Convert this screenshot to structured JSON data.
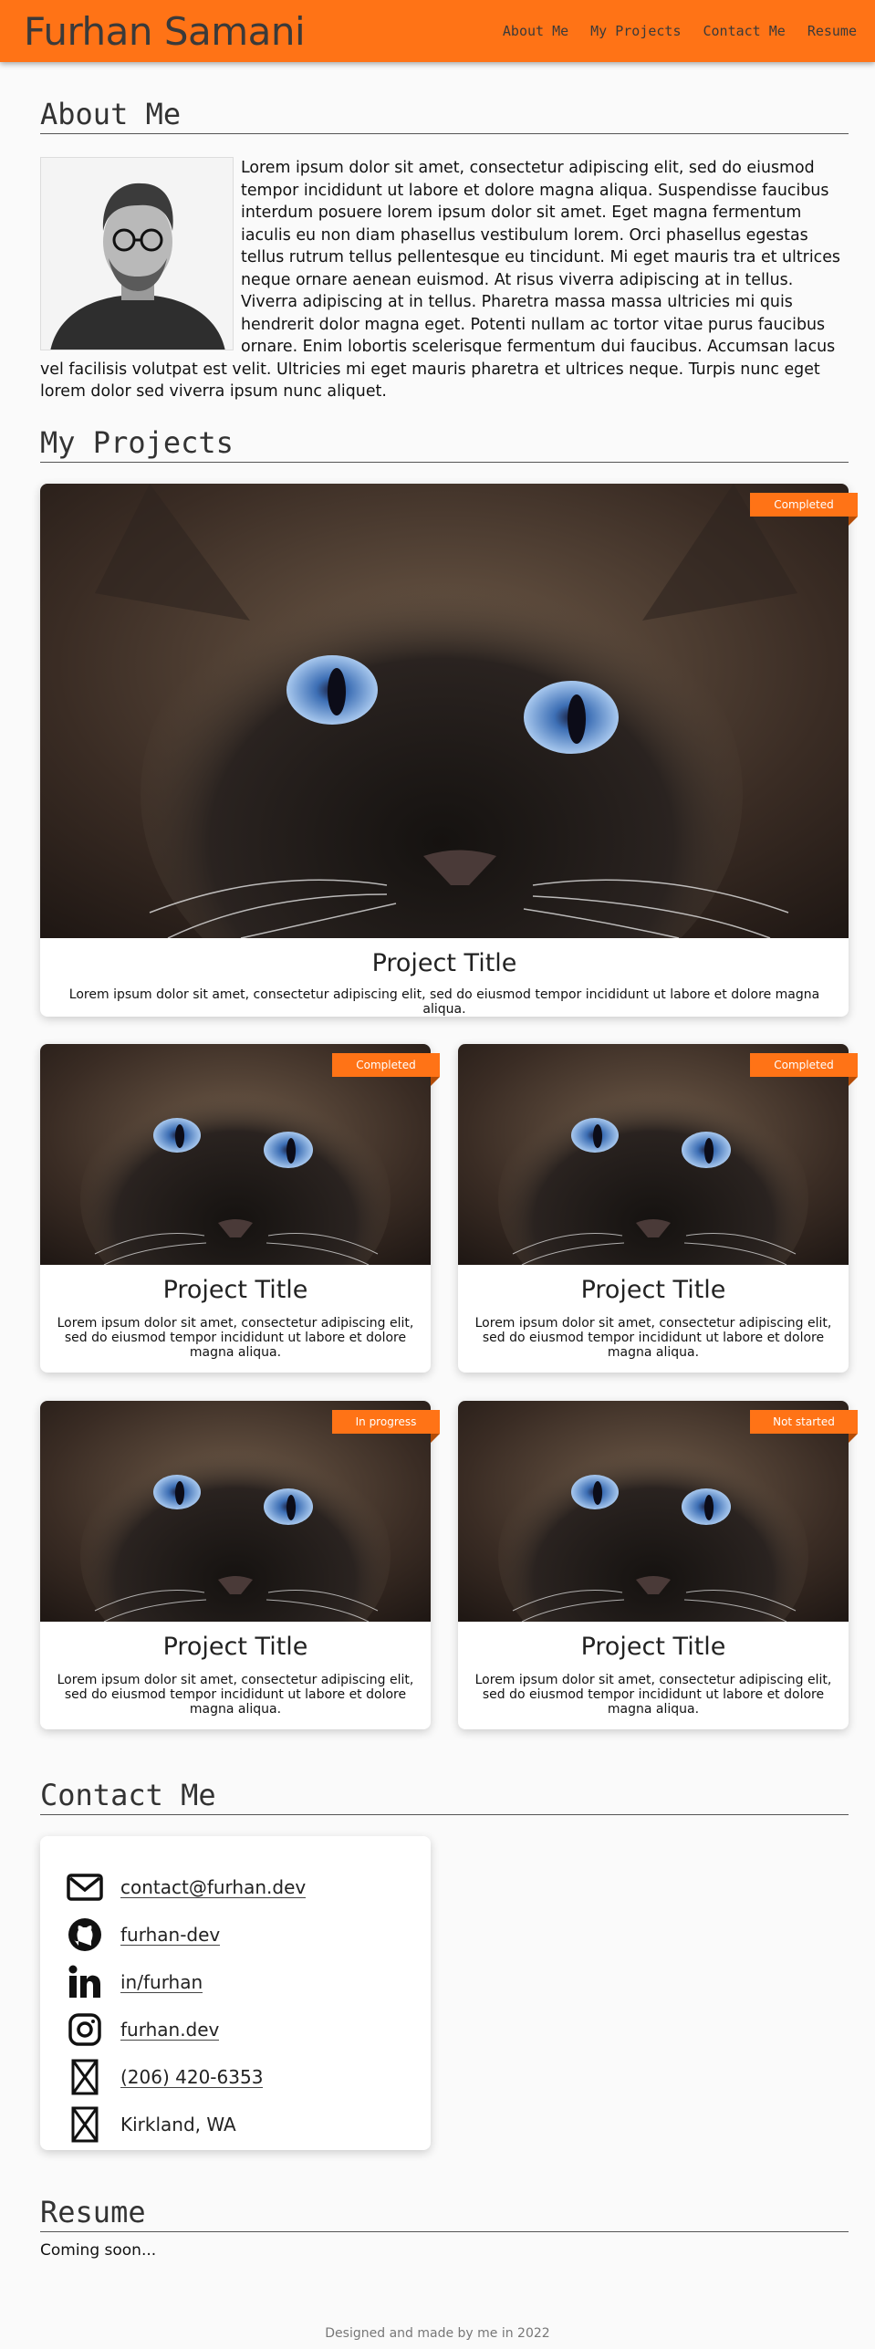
{
  "site": {
    "title": "Furhan Samani"
  },
  "nav": [
    "About Me",
    "My Projects",
    "Contact Me",
    "Resume"
  ],
  "about": {
    "heading": "About Me",
    "text": "Lorem ipsum dolor sit amet, consectetur adipiscing elit, sed do eiusmod tempor incididunt ut labore et dolore magna aliqua. Suspendisse faucibus interdum posuere lorem ipsum dolor sit amet. Eget magna fermentum iaculis eu non diam phasellus vestibulum lorem. Orci phasellus egestas tellus rutrum tellus pellentesque eu tincidunt. Mi eget mauris tra et ultrices neque ornare aenean euismod. At risus viverra adipiscing at in tellus. Viverra adipiscing at in tellus. Pharetra massa massa ultricies mi quis hendrerit dolor magna eget. Potenti nullam ac tortor vitae purus faucibus ornare. Enim lobortis scelerisque fermentum dui faucibus. Accumsan lacus vel facilisis volutpat est velit. Ultricies mi eget mauris pharetra et ultrices neque. Turpis nunc eget lorem dolor sed viverra ipsum nunc aliquet."
  },
  "projects": {
    "heading": "My Projects",
    "items": [
      {
        "title": "Project Title",
        "status": "Completed",
        "description": "Lorem ipsum dolor sit amet, consectetur adipiscing elit, sed do eiusmod tempor incididunt ut labore et dolore magna aliqua."
      },
      {
        "title": "Project Title",
        "status": "Completed",
        "description": "Lorem ipsum dolor sit amet, consectetur adipiscing elit, sed do eiusmod tempor incididunt ut labore et dolore magna aliqua."
      },
      {
        "title": "Project Title",
        "status": "Completed",
        "description": "Lorem ipsum dolor sit amet, consectetur adipiscing elit, sed do eiusmod tempor incididunt ut labore et dolore magna aliqua."
      },
      {
        "title": "Project Title",
        "status": "In progress",
        "description": "Lorem ipsum dolor sit amet, consectetur adipiscing elit, sed do eiusmod tempor incididunt ut labore et dolore magna aliqua."
      },
      {
        "title": "Project Title",
        "status": "Not started",
        "description": "Lorem ipsum dolor sit amet, consectetur adipiscing elit, sed do eiusmod tempor incididunt ut labore et dolore magna aliqua."
      }
    ]
  },
  "contact": {
    "heading": "Contact Me",
    "items": [
      {
        "icon": "envelope-icon",
        "text": "contact@furhan.dev"
      },
      {
        "icon": "github-icon",
        "text": "furhan-dev"
      },
      {
        "icon": "linkedin-icon",
        "text": "in/furhan"
      },
      {
        "icon": "instagram-icon",
        "text": "furhan.dev"
      },
      {
        "icon": "phone-icon",
        "text": "(206) 420-6353"
      },
      {
        "icon": "location-icon",
        "text": "Kirkland, WA"
      }
    ]
  },
  "resume": {
    "heading": "Resume",
    "text": "Coming soon..."
  },
  "footer": {
    "text": "Designed and made by me in 2022"
  },
  "colors": {
    "accent": "#ff7316",
    "badge_fold": "#b24c08"
  }
}
